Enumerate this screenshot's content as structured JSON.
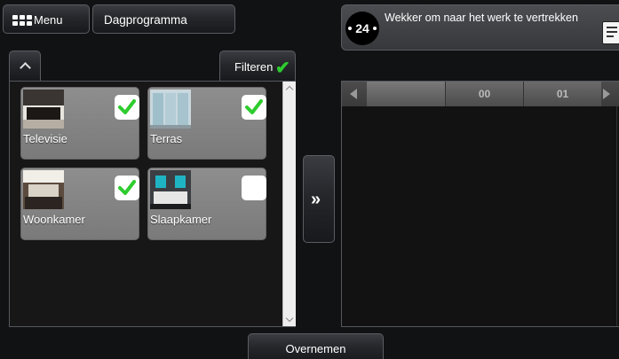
{
  "topbar": {
    "menu_label": "Menu",
    "program_label": "Dagprogramma"
  },
  "alarm": {
    "badge": "24",
    "title": "Wekker om naar het werk te vertrekken"
  },
  "left": {
    "filter_label": "Filteren",
    "rooms": [
      {
        "name": "Televisie",
        "checked": true
      },
      {
        "name": "Terras",
        "checked": true
      },
      {
        "name": "Woonkamer",
        "checked": true
      },
      {
        "name": "Slaapkamer",
        "checked": false
      }
    ]
  },
  "timeline": {
    "hours": [
      "00",
      "01"
    ]
  },
  "bottom": {
    "apply_label": "Overnemen"
  },
  "colors": {
    "check": "#2ecc2e",
    "tile": "#8a8a8a"
  }
}
